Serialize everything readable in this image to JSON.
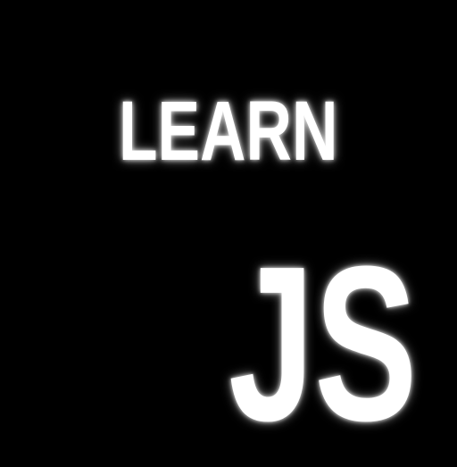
{
  "headline": "LEARN",
  "subject": "JS",
  "colors": {
    "background": "#000000",
    "text": "#ffffff"
  }
}
